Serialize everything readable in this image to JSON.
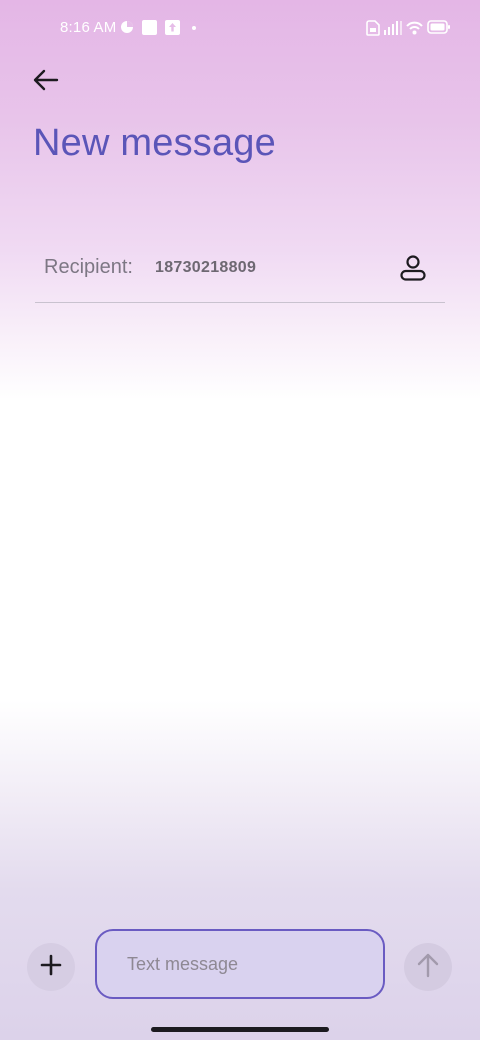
{
  "status_bar": {
    "time": "8:16 AM",
    "left_icons": [
      "data-saver-icon",
      "square-notification-icon",
      "upload-icon",
      "dot-icon"
    ],
    "right_icons": [
      "sim-icon",
      "signal-icon",
      "wifi-icon",
      "battery-icon"
    ]
  },
  "header": {
    "back_icon": "arrow-left-icon",
    "title": "New message"
  },
  "recipient": {
    "label": "Recipient:",
    "value": "18730218809",
    "contact_icon": "person-icon"
  },
  "composer": {
    "attach_icon": "plus-icon",
    "placeholder": "Text message",
    "value": "",
    "send_icon": "arrow-up-icon"
  },
  "colors": {
    "title": "#5b55b8",
    "input_border": "#6a5bc2",
    "input_fill": "#d9d2ef",
    "button_fill": "#d6cde3"
  }
}
